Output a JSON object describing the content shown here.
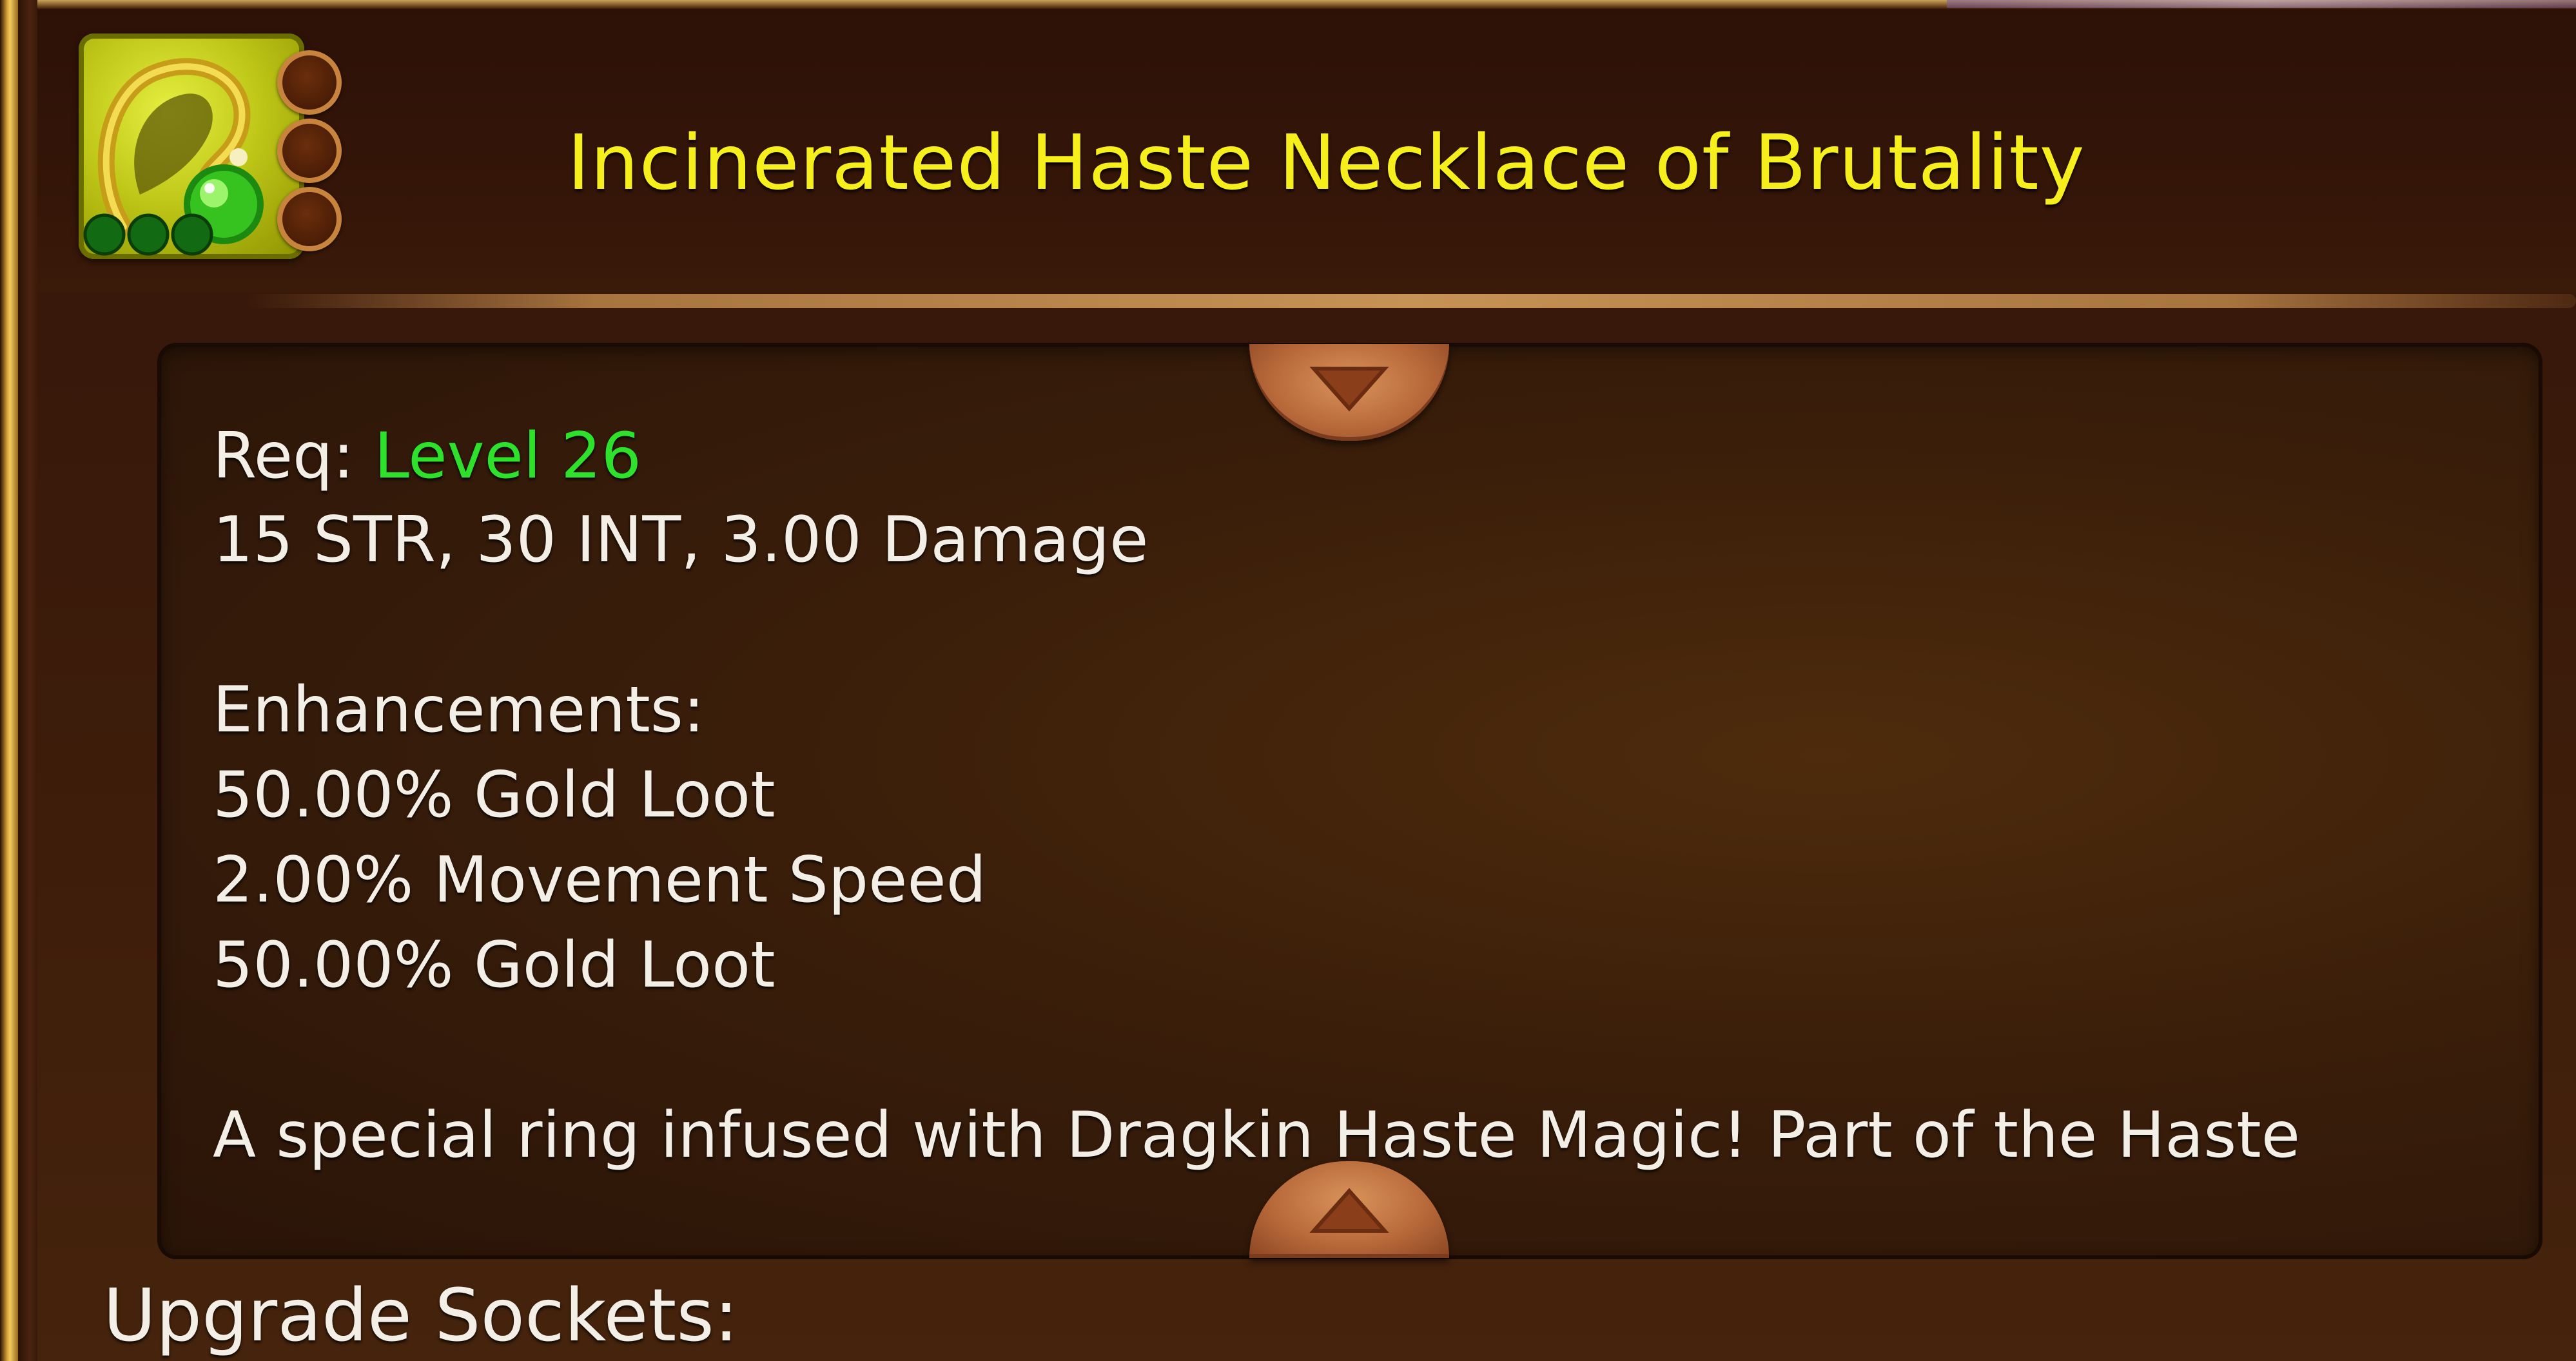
{
  "item": {
    "name": "Incinerated Haste Necklace of Brutality",
    "icon": "necklace-icon",
    "title_color": "#f6ef1c",
    "gems_filled": 3,
    "upgrade_sockets_total": 3
  },
  "requirements": {
    "label": "Req:",
    "level": "Level 26",
    "level_color": "#2ee12a",
    "stats": "15 STR, 30 INT, 3.00 Damage"
  },
  "enhancements": {
    "header": "Enhancements:",
    "lines": [
      "50.00% Gold Loot",
      "2.00% Movement Speed",
      "50.00% Gold Loot"
    ]
  },
  "description": "A special ring infused with Dragkin Haste Magic! Part of the Haste",
  "controls": {
    "scroll_up_icon": "chevron-up-icon",
    "scroll_down_icon": "chevron-down-icon"
  },
  "upgrade_sockets_label": "Upgrade Sockets:"
}
